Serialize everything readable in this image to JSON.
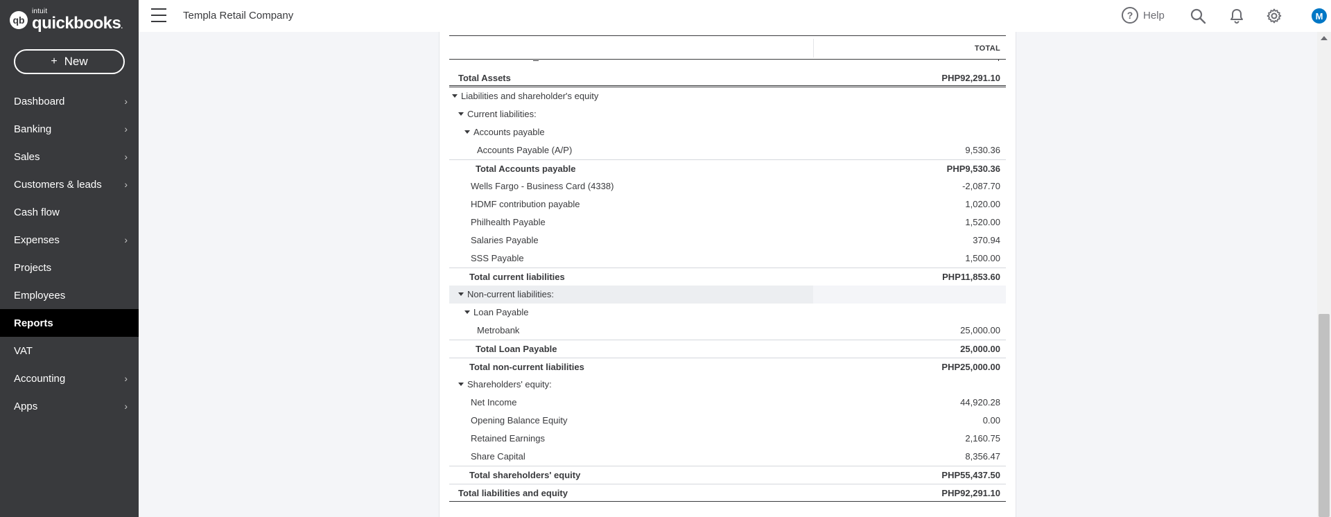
{
  "brand": {
    "intuit": "intuit",
    "name": "quickbooks",
    "mark": "qb"
  },
  "sidebar": {
    "new_label": "New",
    "items": [
      {
        "label": "Dashboard",
        "chevron": true,
        "active": false
      },
      {
        "label": "Banking",
        "chevron": true,
        "active": false
      },
      {
        "label": "Sales",
        "chevron": true,
        "active": false
      },
      {
        "label": "Customers & leads",
        "chevron": true,
        "active": false
      },
      {
        "label": "Cash flow",
        "chevron": false,
        "active": false
      },
      {
        "label": "Expenses",
        "chevron": true,
        "active": false
      },
      {
        "label": "Projects",
        "chevron": false,
        "active": false
      },
      {
        "label": "Employees",
        "chevron": false,
        "active": false
      },
      {
        "label": "Reports",
        "chevron": false,
        "active": true
      },
      {
        "label": "VAT",
        "chevron": false,
        "active": false
      },
      {
        "label": "Accounting",
        "chevron": true,
        "active": false
      },
      {
        "label": "Apps",
        "chevron": true,
        "active": false
      }
    ]
  },
  "header": {
    "company": "Templa Retail Company",
    "help_label": "Help",
    "avatar_initial": "M"
  },
  "report": {
    "column_header": "TOTAL",
    "rows": [
      {
        "label": "Total Assets",
        "amount": "PHP92,291.10",
        "indent": 0,
        "total": true,
        "caret": false,
        "style": "assets"
      },
      {
        "label": "Liabilities and shareholder's equity",
        "amount": "",
        "indent": 0,
        "total": false,
        "caret": true
      },
      {
        "label": "Current liabilities:",
        "amount": "",
        "indent": 1,
        "total": false,
        "caret": true
      },
      {
        "label": "Accounts payable",
        "amount": "",
        "indent": 2,
        "total": false,
        "caret": true
      },
      {
        "label": "Accounts Payable (A/P)",
        "amount": "9,530.36",
        "indent": 3,
        "total": false,
        "caret": false
      },
      {
        "label": "Total Accounts payable",
        "amount": "PHP9,530.36",
        "indent": 3,
        "total": true,
        "caret": false
      },
      {
        "label": "Wells Fargo - Business Card (4338)",
        "amount": "-2,087.70",
        "indent": 2,
        "total": false,
        "caret": false
      },
      {
        "label": "HDMF contribution payable",
        "amount": "1,020.00",
        "indent": 2,
        "total": false,
        "caret": false
      },
      {
        "label": "Philhealth Payable",
        "amount": "1,520.00",
        "indent": 2,
        "total": false,
        "caret": false
      },
      {
        "label": "Salaries Payable",
        "amount": "370.94",
        "indent": 2,
        "total": false,
        "caret": false
      },
      {
        "label": "SSS Payable",
        "amount": "1,500.00",
        "indent": 2,
        "total": false,
        "caret": false
      },
      {
        "label": "Total current liabilities",
        "amount": "PHP11,853.60",
        "indent": 2,
        "total": true,
        "caret": false
      },
      {
        "label": "Non-current liabilities:",
        "amount": "",
        "indent": 1,
        "total": false,
        "caret": true,
        "highlight": true
      },
      {
        "label": "Loan Payable",
        "amount": "",
        "indent": 2,
        "total": false,
        "caret": true
      },
      {
        "label": "Metrobank",
        "amount": "25,000.00",
        "indent": 3,
        "total": false,
        "caret": false
      },
      {
        "label": "Total Loan Payable",
        "amount": "25,000.00",
        "indent": 3,
        "total": true,
        "caret": false
      },
      {
        "label": "Total non-current liabilities",
        "amount": "PHP25,000.00",
        "indent": 2,
        "total": true,
        "caret": false
      },
      {
        "label": "Shareholders' equity:",
        "amount": "",
        "indent": 1,
        "total": false,
        "caret": true
      },
      {
        "label": "Net Income",
        "amount": "44,920.28",
        "indent": 2,
        "total": false,
        "caret": false
      },
      {
        "label": "Opening Balance Equity",
        "amount": "0.00",
        "indent": 2,
        "total": false,
        "caret": false
      },
      {
        "label": "Retained Earnings",
        "amount": "2,160.75",
        "indent": 2,
        "total": false,
        "caret": false
      },
      {
        "label": "Share Capital",
        "amount": "8,356.47",
        "indent": 2,
        "total": false,
        "caret": false
      },
      {
        "label": "Total shareholders' equity",
        "amount": "PHP55,437.50",
        "indent": 2,
        "total": true,
        "caret": false
      },
      {
        "label": "Total liabilities and equity",
        "amount": "PHP92,291.10",
        "indent": 0,
        "total": true,
        "caret": false,
        "style": "grand"
      }
    ]
  },
  "icons": {
    "help": "question-circle-icon",
    "search": "search-icon",
    "notifications": "bell-icon",
    "settings": "gear-icon",
    "menu": "hamburger-icon"
  }
}
